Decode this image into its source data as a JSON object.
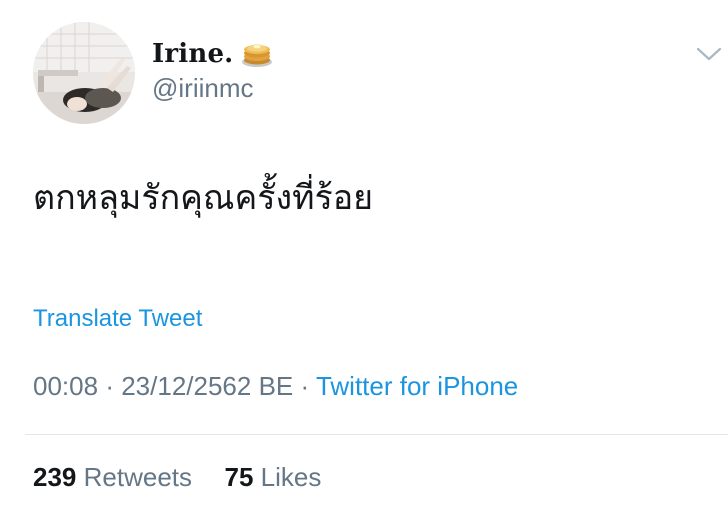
{
  "author": {
    "display_name": "Irine.",
    "name_emoji_icon": "pancakes-icon",
    "handle": "@iriinmc",
    "avatar": "profile-photo"
  },
  "tweet": {
    "text": "ตกหลุมรักคุณครั้งที่ร้อย",
    "translate_label": "Translate Tweet"
  },
  "meta": {
    "time": "00:08",
    "separator": "·",
    "date": "23/12/2562 BE",
    "source": "Twitter for iPhone"
  },
  "stats": {
    "retweets_count": "239",
    "retweets_label": "Retweets",
    "likes_count": "75",
    "likes_label": "Likes"
  },
  "colors": {
    "link": "#1b95e0",
    "secondary_text": "#657786",
    "primary_text": "#14171a",
    "divider": "#e1e8ed"
  }
}
